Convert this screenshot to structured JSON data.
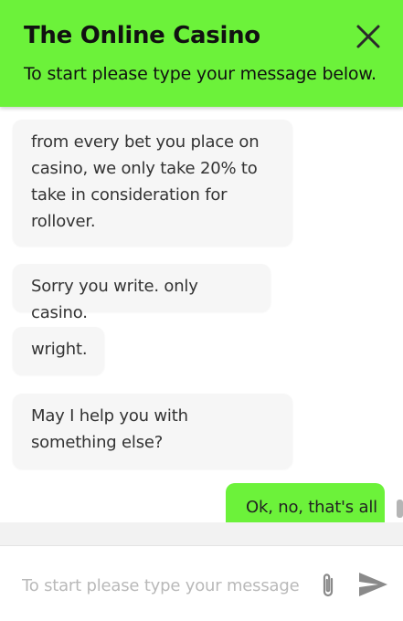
{
  "header": {
    "title": "The Online Casino",
    "subtitle": "To start please type your message below.",
    "close_icon": "close-icon"
  },
  "messages": [
    {
      "from": "agent",
      "text": "from every bet you place on casino, we only take 20% to take in consideration for rollover."
    },
    {
      "from": "agent",
      "text": "Sorry you write. only casino."
    },
    {
      "from": "agent",
      "text": "wright."
    },
    {
      "from": "agent",
      "text": "May I help you with something else?"
    },
    {
      "from": "user",
      "text": "Ok, no, that's all"
    }
  ],
  "composer": {
    "placeholder": "To start please type your message here...",
    "value": "",
    "attach_icon": "paperclip-icon",
    "send_icon": "send-icon"
  },
  "colors": {
    "accent": "#6cf23a",
    "agent_bubble": "#f6f6f6",
    "text": "#333333",
    "icon": "#8a8a8a"
  }
}
